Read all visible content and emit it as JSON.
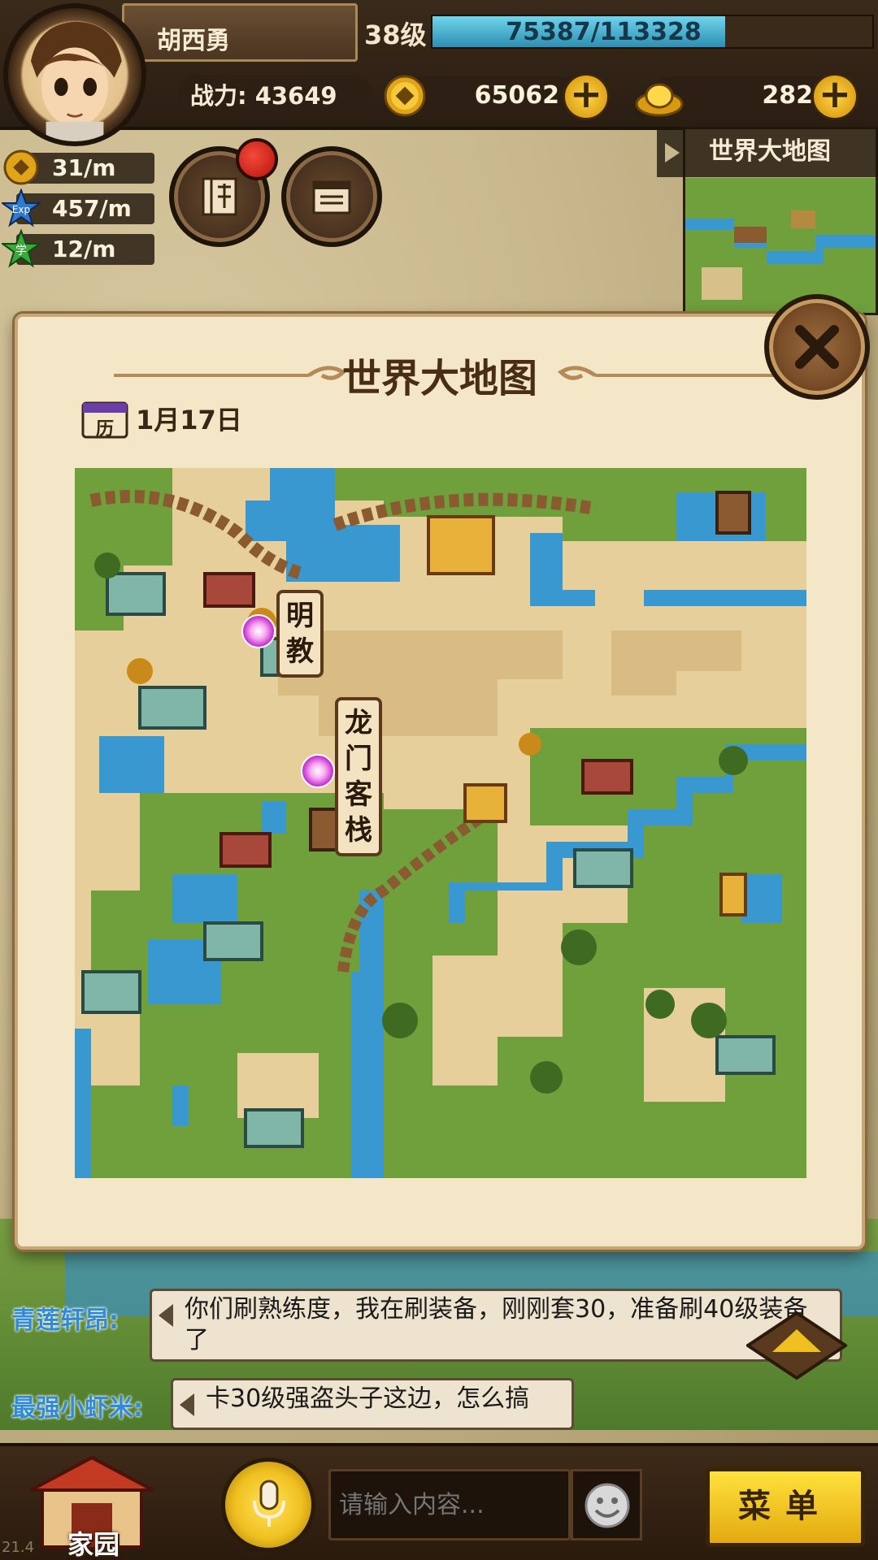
{
  "player": {
    "name": "胡西勇",
    "level": "38级",
    "exp": "75387/113328",
    "exp_fraction": 0.665,
    "power": "战力: 43649"
  },
  "currency": {
    "coins": "65062",
    "gold": "282"
  },
  "rates": {
    "coin_rate": "31/m",
    "exp_rate": "457/m",
    "study_rate": "12/m"
  },
  "minimap": {
    "label": "世界大地图"
  },
  "dialog": {
    "title": "世界大地图",
    "date": "1月17日",
    "calendar_glyph": "历",
    "locations": [
      {
        "name": "明教"
      },
      {
        "name": "龙门客栈"
      }
    ]
  },
  "chat": {
    "messages": [
      {
        "sender": "青莲轩昂:",
        "text": "你们刷熟练度，我在刷装备，刚刚套30，准备刷40级装备了"
      },
      {
        "sender": "最强小虾米:",
        "text": "卡30级强盗头子这边，怎么搞"
      }
    ]
  },
  "bottom": {
    "home_label": "家园",
    "input_placeholder": "请输入内容...",
    "menu_label": "菜单"
  },
  "version": "21.4",
  "icons": {
    "coin": "coin-icon",
    "gold": "gold-ingot-icon",
    "exp": "exp-star-icon",
    "study": "study-star-icon",
    "book": "book-icon",
    "notice": "notice-icon",
    "close": "close-icon",
    "mic": "microphone-icon",
    "emoji": "smiley-icon",
    "collapse": "chevron-up-icon"
  },
  "colors": {
    "exp_bar": "#2e8fb2",
    "menu_button": "#f0c020",
    "chat_name": "#2f8ad8",
    "notification": "#d81f14"
  }
}
